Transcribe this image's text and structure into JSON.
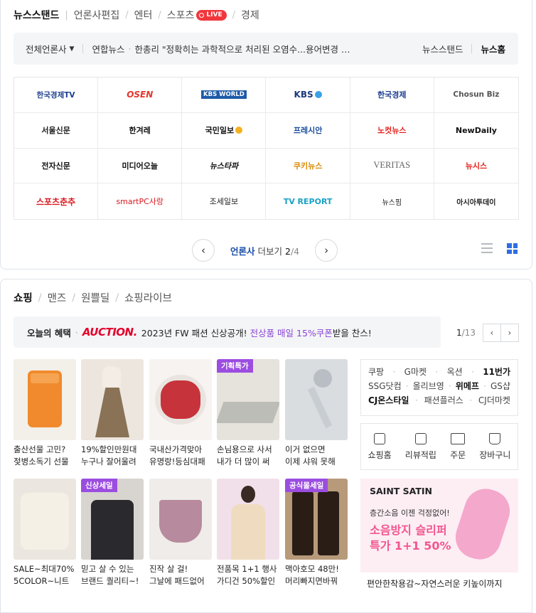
{
  "news": {
    "tabs": [
      "뉴스스탠드",
      "언론사편집",
      "엔터",
      "스포츠",
      "경제"
    ],
    "live": "LIVE",
    "ticker": {
      "all_press": "전체언론사",
      "source": "연합뉴스",
      "headline": "한총리 \"정확히는 과학적으로 처리된 오염수...용어변경 검...",
      "link1": "뉴스스탠드",
      "link2": "뉴스홈"
    },
    "press": [
      "한국경제TV",
      "OSEN",
      "KBS WORLD",
      "KBS",
      "한국경제",
      "Chosun Biz",
      "서울신문",
      "한겨레",
      "국민일보",
      "프레시안",
      "노컷뉴스",
      "NewDaily",
      "전자신문",
      "미디어오늘",
      "뉴스타파",
      "쿠키뉴스",
      "VERITAS",
      "뉴시스",
      "스포츠춘추",
      "smartPC사랑",
      "조세일보",
      "TV REPORT",
      "뉴스핌",
      "아시아투데이"
    ],
    "pager": {
      "label": "언론사",
      "more": "더보기",
      "current": "2",
      "total": "/4"
    }
  },
  "shopping": {
    "tabs": [
      "쇼핑",
      "맨즈",
      "원쁠딜",
      "쇼핑라이브"
    ],
    "benefit": {
      "label": "오늘의 혜택",
      "brand": "AUCTION.",
      "text": "2023년 FW 패션 신상공개!",
      "highlight": "전상품 매일 15%쿠폰",
      "tail": "받을 찬스!",
      "page": "1",
      "total": "/13"
    },
    "products": [
      {
        "l1": "출산선물 고민?",
        "l2": "젖병소독기 선물",
        "tag": ""
      },
      {
        "l1": "19%할인만원대",
        "l2": "누구나 잘어울려",
        "tag": ""
      },
      {
        "l1": "국내산가격맞아",
        "l2": "유명랑!등심대패",
        "tag": ""
      },
      {
        "l1": "손님용으로 사서",
        "l2": "내가 더 많이 써",
        "tag": "기획특가"
      },
      {
        "l1": "이거 없으면",
        "l2": "이제 샤워 못해",
        "tag": ""
      },
      {
        "l1": "SALE~최대70%↓",
        "l2": "5COLOR~니트",
        "tag": ""
      },
      {
        "l1": "믿고 살 수 있는",
        "l2": "브랜드 퀄리티~!",
        "tag": "신상세일"
      },
      {
        "l1": "진작 살 걸!",
        "l2": "그날에 패드없어",
        "tag": ""
      },
      {
        "l1": "전품목 1+1 행사",
        "l2": "가디건 50%할인",
        "tag": ""
      },
      {
        "l1": "맥아호모 48만!",
        "l2": "머리빠지면바꿔",
        "tag": "공식몰세일"
      }
    ],
    "malls": [
      [
        "쿠팡",
        "G마켓",
        "옥션",
        "11번가"
      ],
      [
        "SSG닷컴",
        "올리브영",
        "위메프",
        "GS샵"
      ],
      [
        "CJ온스타일",
        "패션플러스",
        "CJ더마켓"
      ]
    ],
    "quick": [
      "쇼핑홈",
      "리뷰적립",
      "주문",
      "장바구니"
    ],
    "banner": {
      "brand": "SAINT SATIN",
      "t1": "층간소음 이젠 걱정없어!",
      "t2a": "소음방지 슬리퍼",
      "t2b": "특가 1+1 50%",
      "caption": "편안한착용감~자연스러운 키높이까지"
    }
  }
}
